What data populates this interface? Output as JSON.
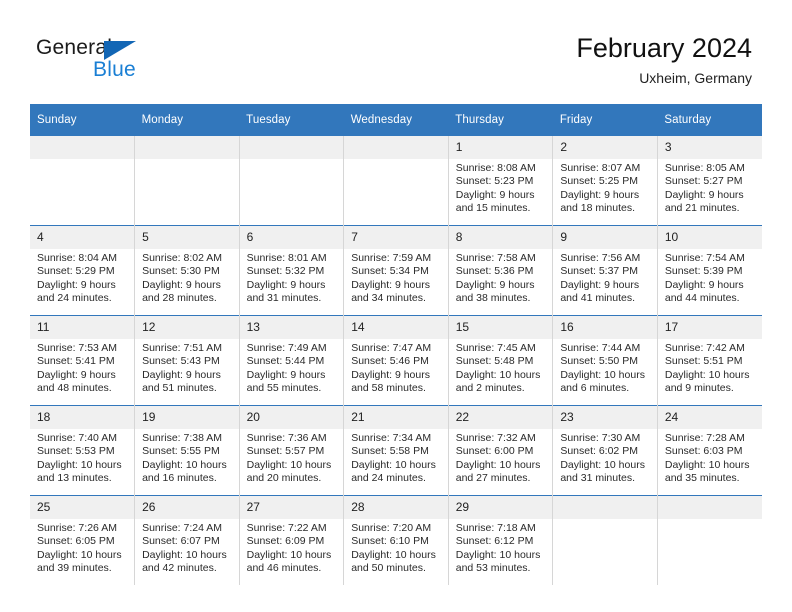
{
  "brand": {
    "name_top": "General",
    "name_bottom": "Blue",
    "triangle_color": "#1266b5",
    "blue_text_color": "#1a7fd4"
  },
  "header": {
    "title": "February 2024",
    "subtitle": "Uxheim, Germany"
  },
  "theme": {
    "header_blue": "#3277bc",
    "daynum_gray": "#f0f0f0",
    "grid_line": "#d6d6d6"
  },
  "weekday_headers": [
    "Sunday",
    "Monday",
    "Tuesday",
    "Wednesday",
    "Thursday",
    "Friday",
    "Saturday"
  ],
  "weeks": [
    [
      {
        "day": "",
        "sunrise": "",
        "sunset": "",
        "daylight_1": "",
        "daylight_2": ""
      },
      {
        "day": "",
        "sunrise": "",
        "sunset": "",
        "daylight_1": "",
        "daylight_2": ""
      },
      {
        "day": "",
        "sunrise": "",
        "sunset": "",
        "daylight_1": "",
        "daylight_2": ""
      },
      {
        "day": "",
        "sunrise": "",
        "sunset": "",
        "daylight_1": "",
        "daylight_2": ""
      },
      {
        "day": "1",
        "sunrise": "Sunrise: 8:08 AM",
        "sunset": "Sunset: 5:23 PM",
        "daylight_1": "Daylight: 9 hours",
        "daylight_2": "and 15 minutes."
      },
      {
        "day": "2",
        "sunrise": "Sunrise: 8:07 AM",
        "sunset": "Sunset: 5:25 PM",
        "daylight_1": "Daylight: 9 hours",
        "daylight_2": "and 18 minutes."
      },
      {
        "day": "3",
        "sunrise": "Sunrise: 8:05 AM",
        "sunset": "Sunset: 5:27 PM",
        "daylight_1": "Daylight: 9 hours",
        "daylight_2": "and 21 minutes."
      }
    ],
    [
      {
        "day": "4",
        "sunrise": "Sunrise: 8:04 AM",
        "sunset": "Sunset: 5:29 PM",
        "daylight_1": "Daylight: 9 hours",
        "daylight_2": "and 24 minutes."
      },
      {
        "day": "5",
        "sunrise": "Sunrise: 8:02 AM",
        "sunset": "Sunset: 5:30 PM",
        "daylight_1": "Daylight: 9 hours",
        "daylight_2": "and 28 minutes."
      },
      {
        "day": "6",
        "sunrise": "Sunrise: 8:01 AM",
        "sunset": "Sunset: 5:32 PM",
        "daylight_1": "Daylight: 9 hours",
        "daylight_2": "and 31 minutes."
      },
      {
        "day": "7",
        "sunrise": "Sunrise: 7:59 AM",
        "sunset": "Sunset: 5:34 PM",
        "daylight_1": "Daylight: 9 hours",
        "daylight_2": "and 34 minutes."
      },
      {
        "day": "8",
        "sunrise": "Sunrise: 7:58 AM",
        "sunset": "Sunset: 5:36 PM",
        "daylight_1": "Daylight: 9 hours",
        "daylight_2": "and 38 minutes."
      },
      {
        "day": "9",
        "sunrise": "Sunrise: 7:56 AM",
        "sunset": "Sunset: 5:37 PM",
        "daylight_1": "Daylight: 9 hours",
        "daylight_2": "and 41 minutes."
      },
      {
        "day": "10",
        "sunrise": "Sunrise: 7:54 AM",
        "sunset": "Sunset: 5:39 PM",
        "daylight_1": "Daylight: 9 hours",
        "daylight_2": "and 44 minutes."
      }
    ],
    [
      {
        "day": "11",
        "sunrise": "Sunrise: 7:53 AM",
        "sunset": "Sunset: 5:41 PM",
        "daylight_1": "Daylight: 9 hours",
        "daylight_2": "and 48 minutes."
      },
      {
        "day": "12",
        "sunrise": "Sunrise: 7:51 AM",
        "sunset": "Sunset: 5:43 PM",
        "daylight_1": "Daylight: 9 hours",
        "daylight_2": "and 51 minutes."
      },
      {
        "day": "13",
        "sunrise": "Sunrise: 7:49 AM",
        "sunset": "Sunset: 5:44 PM",
        "daylight_1": "Daylight: 9 hours",
        "daylight_2": "and 55 minutes."
      },
      {
        "day": "14",
        "sunrise": "Sunrise: 7:47 AM",
        "sunset": "Sunset: 5:46 PM",
        "daylight_1": "Daylight: 9 hours",
        "daylight_2": "and 58 minutes."
      },
      {
        "day": "15",
        "sunrise": "Sunrise: 7:45 AM",
        "sunset": "Sunset: 5:48 PM",
        "daylight_1": "Daylight: 10 hours",
        "daylight_2": "and 2 minutes."
      },
      {
        "day": "16",
        "sunrise": "Sunrise: 7:44 AM",
        "sunset": "Sunset: 5:50 PM",
        "daylight_1": "Daylight: 10 hours",
        "daylight_2": "and 6 minutes."
      },
      {
        "day": "17",
        "sunrise": "Sunrise: 7:42 AM",
        "sunset": "Sunset: 5:51 PM",
        "daylight_1": "Daylight: 10 hours",
        "daylight_2": "and 9 minutes."
      }
    ],
    [
      {
        "day": "18",
        "sunrise": "Sunrise: 7:40 AM",
        "sunset": "Sunset: 5:53 PM",
        "daylight_1": "Daylight: 10 hours",
        "daylight_2": "and 13 minutes."
      },
      {
        "day": "19",
        "sunrise": "Sunrise: 7:38 AM",
        "sunset": "Sunset: 5:55 PM",
        "daylight_1": "Daylight: 10 hours",
        "daylight_2": "and 16 minutes."
      },
      {
        "day": "20",
        "sunrise": "Sunrise: 7:36 AM",
        "sunset": "Sunset: 5:57 PM",
        "daylight_1": "Daylight: 10 hours",
        "daylight_2": "and 20 minutes."
      },
      {
        "day": "21",
        "sunrise": "Sunrise: 7:34 AM",
        "sunset": "Sunset: 5:58 PM",
        "daylight_1": "Daylight: 10 hours",
        "daylight_2": "and 24 minutes."
      },
      {
        "day": "22",
        "sunrise": "Sunrise: 7:32 AM",
        "sunset": "Sunset: 6:00 PM",
        "daylight_1": "Daylight: 10 hours",
        "daylight_2": "and 27 minutes."
      },
      {
        "day": "23",
        "sunrise": "Sunrise: 7:30 AM",
        "sunset": "Sunset: 6:02 PM",
        "daylight_1": "Daylight: 10 hours",
        "daylight_2": "and 31 minutes."
      },
      {
        "day": "24",
        "sunrise": "Sunrise: 7:28 AM",
        "sunset": "Sunset: 6:03 PM",
        "daylight_1": "Daylight: 10 hours",
        "daylight_2": "and 35 minutes."
      }
    ],
    [
      {
        "day": "25",
        "sunrise": "Sunrise: 7:26 AM",
        "sunset": "Sunset: 6:05 PM",
        "daylight_1": "Daylight: 10 hours",
        "daylight_2": "and 39 minutes."
      },
      {
        "day": "26",
        "sunrise": "Sunrise: 7:24 AM",
        "sunset": "Sunset: 6:07 PM",
        "daylight_1": "Daylight: 10 hours",
        "daylight_2": "and 42 minutes."
      },
      {
        "day": "27",
        "sunrise": "Sunrise: 7:22 AM",
        "sunset": "Sunset: 6:09 PM",
        "daylight_1": "Daylight: 10 hours",
        "daylight_2": "and 46 minutes."
      },
      {
        "day": "28",
        "sunrise": "Sunrise: 7:20 AM",
        "sunset": "Sunset: 6:10 PM",
        "daylight_1": "Daylight: 10 hours",
        "daylight_2": "and 50 minutes."
      },
      {
        "day": "29",
        "sunrise": "Sunrise: 7:18 AM",
        "sunset": "Sunset: 6:12 PM",
        "daylight_1": "Daylight: 10 hours",
        "daylight_2": "and 53 minutes."
      },
      {
        "day": "",
        "sunrise": "",
        "sunset": "",
        "daylight_1": "",
        "daylight_2": ""
      },
      {
        "day": "",
        "sunrise": "",
        "sunset": "",
        "daylight_1": "",
        "daylight_2": ""
      }
    ]
  ]
}
